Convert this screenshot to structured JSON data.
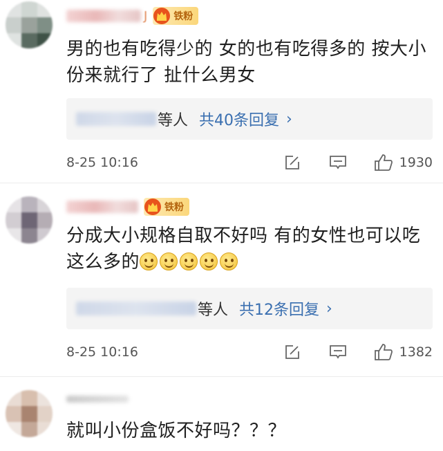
{
  "comments": [
    {
      "name_suffix": "J",
      "fan_badge": "铁粉",
      "text": "男的也有吃得少的 女的也有吃得多的 按大小份来就行了 扯什么男女",
      "reply_who": "等人",
      "reply_total": "共40条回复",
      "time": "8-25 10:16",
      "likes": "1930"
    },
    {
      "name_suffix": "",
      "fan_badge": "铁粉",
      "text": "分成大小规格自取不好吗 有的女性也可以吃这么多的",
      "reply_who": "等人",
      "reply_total": "共12条回复",
      "time": "8-25 10:16",
      "likes": "1382"
    },
    {
      "name_suffix": "",
      "text": "就叫小份盒饭不好吗？？？"
    }
  ],
  "colors": {
    "link_blue": "#3a6fb0",
    "badge_gold": "#fbd77b",
    "reply_bg": "#f4f4f4"
  },
  "icons": [
    "crown-icon",
    "edit-icon",
    "comment-icon",
    "like-icon",
    "chevron-right-icon",
    "smile-emoji-icon",
    "shush-emoji-icon"
  ]
}
